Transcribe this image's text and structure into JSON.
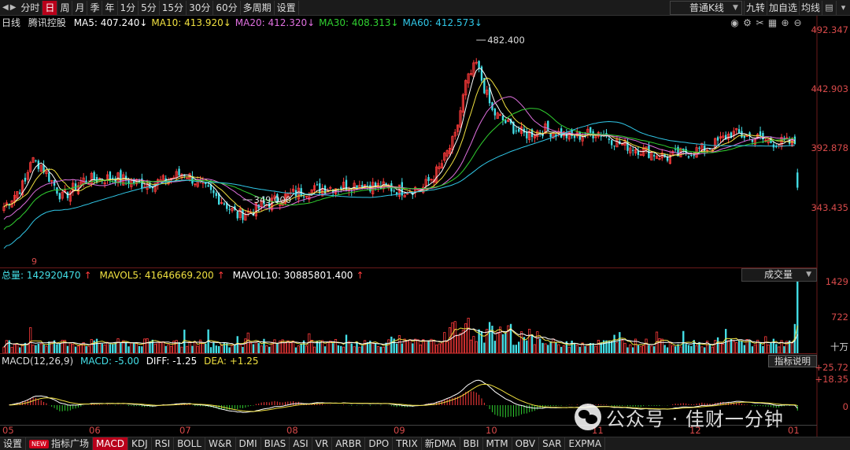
{
  "toolbar": {
    "periods": [
      {
        "label": "分时",
        "active": false
      },
      {
        "label": "日",
        "active": true
      },
      {
        "label": "周",
        "active": false
      },
      {
        "label": "月",
        "active": false
      },
      {
        "label": "季",
        "active": false
      },
      {
        "label": "年",
        "active": false
      },
      {
        "label": "1分",
        "active": false
      },
      {
        "label": "5分",
        "active": false
      },
      {
        "label": "15分",
        "active": false
      },
      {
        "label": "30分",
        "active": false
      },
      {
        "label": "60分",
        "active": false
      },
      {
        "label": "多周期",
        "active": false
      },
      {
        "label": "设置",
        "active": false
      }
    ],
    "ktype_label": "普通K线",
    "jiuzhuan_label": "九转",
    "add_watch_label": "加自选",
    "avg_line_label": "均线"
  },
  "main_chart": {
    "period_label": "日线",
    "stock_name": "腾讯控股",
    "ma": [
      {
        "label": "MA5: 407.240",
        "color": "#ffffff"
      },
      {
        "label": "MA10: 413.920",
        "color": "#f0e040"
      },
      {
        "label": "MA20: 412.320",
        "color": "#e070e0"
      },
      {
        "label": "MA30: 408.313",
        "color": "#30d030"
      },
      {
        "label": "MA60: 412.573",
        "color": "#30c8e8"
      }
    ],
    "price_axis": [
      "492.347",
      "442.903",
      "392.878",
      "343.435"
    ],
    "high_annotation": "482.400",
    "low_annotation": "349.000",
    "start_marker": "9"
  },
  "volume": {
    "total_label": "总量: 142920470",
    "mavol5_label": "MAVOL5: 41646669.200",
    "mavol10_label": "MAVOL10: 30885801.400",
    "selector_label": "成交量",
    "axis": [
      "1429",
      "722"
    ],
    "unit": "十万"
  },
  "macd": {
    "params_label": "MACD(12,26,9)",
    "macd_label": "MACD: -5.00",
    "diff_label": "DIFF: -1.25",
    "dea_label": "DEA: +1.25",
    "help_label": "指标说明",
    "axis": [
      "+25.72",
      "+18.35",
      "0"
    ]
  },
  "date_axis": [
    "05",
    "06",
    "07",
    "08",
    "09",
    "10",
    "11",
    "12",
    "01"
  ],
  "bottom_tabs": [
    {
      "label": "设置",
      "active": false,
      "badge": ""
    },
    {
      "label": "指标广场",
      "active": false,
      "badge": "NEW"
    },
    {
      "label": "MACD",
      "active": true,
      "badge": ""
    },
    {
      "label": "KDJ",
      "active": false,
      "badge": ""
    },
    {
      "label": "RSI",
      "active": false,
      "badge": ""
    },
    {
      "label": "BOLL",
      "active": false,
      "badge": ""
    },
    {
      "label": "W&R",
      "active": false,
      "badge": ""
    },
    {
      "label": "DMI",
      "active": false,
      "badge": ""
    },
    {
      "label": "BIAS",
      "active": false,
      "badge": ""
    },
    {
      "label": "ASI",
      "active": false,
      "badge": ""
    },
    {
      "label": "VR",
      "active": false,
      "badge": ""
    },
    {
      "label": "ARBR",
      "active": false,
      "badge": ""
    },
    {
      "label": "DPO",
      "active": false,
      "badge": ""
    },
    {
      "label": "TRIX",
      "active": false,
      "badge": ""
    },
    {
      "label": "新DMA",
      "active": false,
      "badge": ""
    },
    {
      "label": "BBI",
      "active": false,
      "badge": ""
    },
    {
      "label": "MTM",
      "active": false,
      "badge": ""
    },
    {
      "label": "OBV",
      "active": false,
      "badge": ""
    },
    {
      "label": "SAR",
      "active": false,
      "badge": ""
    },
    {
      "label": "EXPMA",
      "active": false,
      "badge": ""
    }
  ],
  "watermark": "公众号 · 佳财一分钟",
  "colors": {
    "up": "#ff3b3b",
    "down": "#44e0e8",
    "axis_text": "#d84a4a"
  },
  "chart_data": {
    "type": "candlestick",
    "price_range": [
      318,
      505
    ],
    "anchors": [
      [
        0,
        365
      ],
      [
        8,
        384
      ],
      [
        10,
        402
      ],
      [
        14,
        398
      ],
      [
        22,
        372
      ],
      [
        30,
        386
      ],
      [
        42,
        388
      ],
      [
        52,
        383
      ],
      [
        60,
        385
      ],
      [
        68,
        392
      ],
      [
        75,
        380
      ],
      [
        82,
        370
      ],
      [
        88,
        358
      ],
      [
        94,
        362
      ],
      [
        100,
        368
      ],
      [
        110,
        376
      ],
      [
        122,
        380
      ],
      [
        135,
        383
      ],
      [
        150,
        378
      ],
      [
        158,
        380
      ],
      [
        164,
        395
      ],
      [
        170,
        420
      ],
      [
        174,
        462
      ],
      [
        178,
        478
      ],
      [
        184,
        440
      ],
      [
        190,
        430
      ],
      [
        196,
        422
      ],
      [
        204,
        426
      ],
      [
        214,
        420
      ],
      [
        224,
        424
      ],
      [
        232,
        415
      ],
      [
        240,
        410
      ],
      [
        250,
        404
      ],
      [
        258,
        408
      ],
      [
        266,
        412
      ],
      [
        274,
        423
      ],
      [
        282,
        420
      ],
      [
        290,
        416
      ],
      [
        298,
        415
      ]
    ],
    "last_bar": {
      "open": 392,
      "close": 380,
      "high": 395,
      "low": 378
    }
  }
}
